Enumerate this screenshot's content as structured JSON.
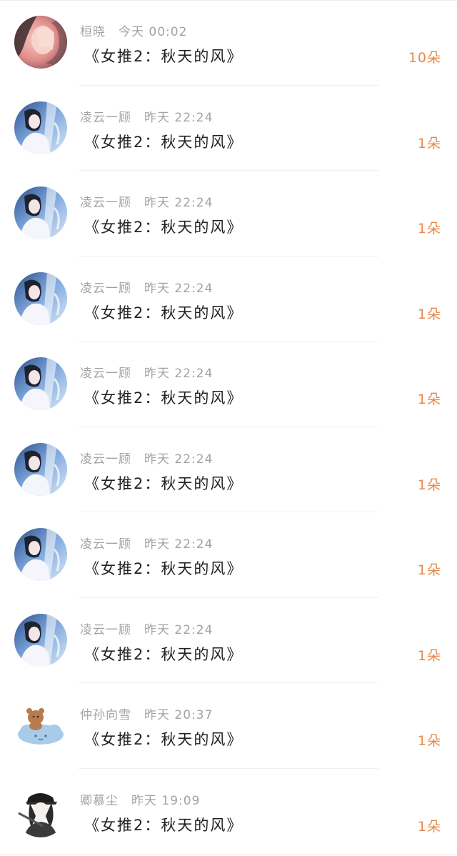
{
  "colors": {
    "meta_text": "#a3a3a3",
    "title_text": "#222222",
    "count_text": "#e8894a",
    "divider": "#f0f0f0"
  },
  "gifts": [
    {
      "user": "桓晓",
      "time": "今天 00:02",
      "title": "《女推2：秋天的风》",
      "count": "10朵",
      "avatar": "girl-hiding-face-avatar"
    },
    {
      "user": "凌云一顾",
      "time": "昨天 22:24",
      "title": "《女推2：秋天的风》",
      "count": "1朵",
      "avatar": "anime-girl-sky-avatar"
    },
    {
      "user": "凌云一顾",
      "time": "昨天 22:24",
      "title": "《女推2：秋天的风》",
      "count": "1朵",
      "avatar": "anime-girl-sky-avatar"
    },
    {
      "user": "凌云一顾",
      "time": "昨天 22:24",
      "title": "《女推2：秋天的风》",
      "count": "1朵",
      "avatar": "anime-girl-sky-avatar"
    },
    {
      "user": "凌云一顾",
      "time": "昨天 22:24",
      "title": "《女推2：秋天的风》",
      "count": "1朵",
      "avatar": "anime-girl-sky-avatar"
    },
    {
      "user": "凌云一顾",
      "time": "昨天 22:24",
      "title": "《女推2：秋天的风》",
      "count": "1朵",
      "avatar": "anime-girl-sky-avatar"
    },
    {
      "user": "凌云一顾",
      "time": "昨天 22:24",
      "title": "《女推2：秋天的风》",
      "count": "1朵",
      "avatar": "anime-girl-sky-avatar"
    },
    {
      "user": "凌云一顾",
      "time": "昨天 22:24",
      "title": "《女推2：秋天的风》",
      "count": "1朵",
      "avatar": "anime-girl-sky-avatar"
    },
    {
      "user": "仲孙向雪",
      "time": "昨天 20:37",
      "title": "《女推2：秋天的风》",
      "count": "1朵",
      "avatar": "bear-on-cloud-avatar"
    },
    {
      "user": "卿慕尘",
      "time": "昨天 19:09",
      "title": "《女推2：秋天的风》",
      "count": "1朵",
      "avatar": "sketch-girl-cap-avatar"
    }
  ]
}
